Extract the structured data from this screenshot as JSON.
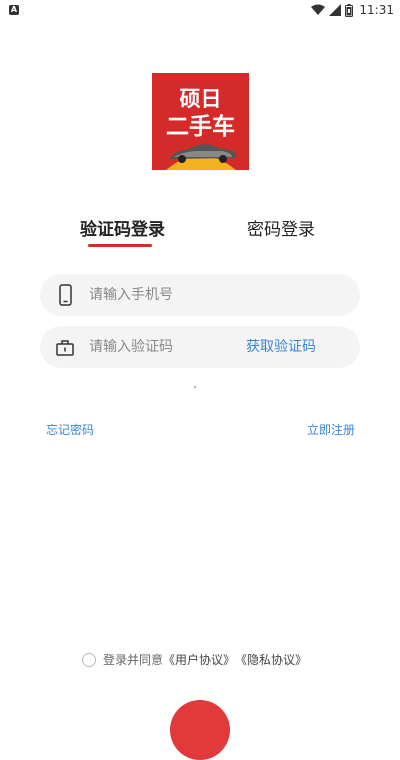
{
  "status_bar": {
    "left_icon_letter": "A",
    "time": "11:31",
    "icons": [
      "wifi-icon",
      "signal-icon",
      "battery-icon"
    ]
  },
  "logo": {
    "line1": "硕日",
    "line2": "二手车",
    "background": "#d42a2a"
  },
  "tabs": {
    "sms_login": "验证码登录",
    "password_login": "密码登录",
    "active": "sms_login"
  },
  "form": {
    "phone": {
      "placeholder": "请输入手机号",
      "value": "",
      "icon": "phone-icon"
    },
    "code": {
      "placeholder": "请输入验证码",
      "value": "",
      "icon": "lock-icon"
    },
    "get_code": "获取验证码"
  },
  "links": {
    "forgot_password": "忘记密码",
    "register": "立即注册"
  },
  "agreement": {
    "prefix": "登录并同意",
    "user_agreement": "《用户协议》",
    "privacy_policy": "《隐私协议》",
    "checked": false
  },
  "colors": {
    "accent": "#d42a2a",
    "link": "#3a86d9"
  }
}
